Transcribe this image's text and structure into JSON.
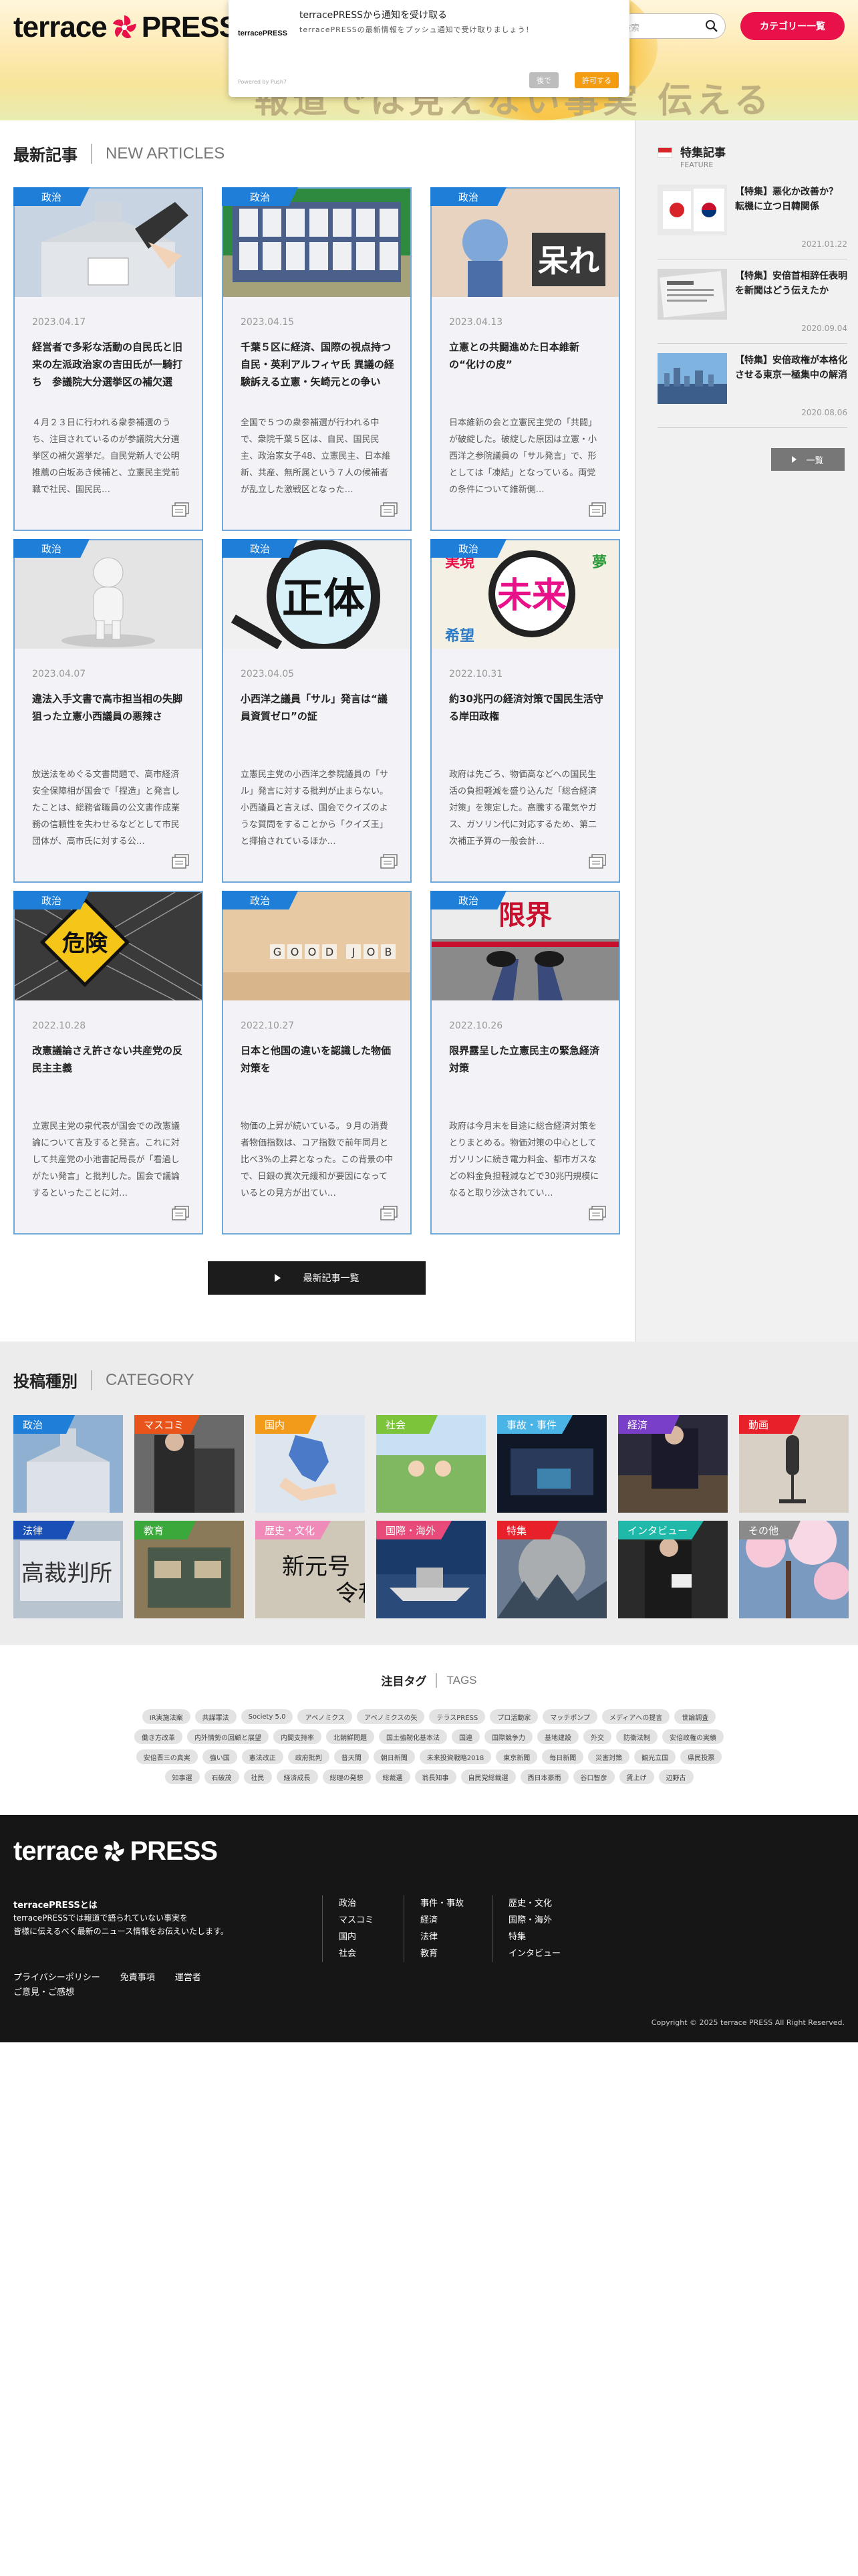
{
  "header": {
    "logo_left": "terrace",
    "logo_right": "PRESS",
    "banner_text": "報道では見えない事実 伝える",
    "search_placeholder": "検索",
    "category_button": "カテゴリー一覧"
  },
  "notification": {
    "logo": "terracePRESS",
    "title": "terracePRESSから通知を受け取る",
    "body": "terracePRESSの最新情報をプッシュ通知で受け取りましょう！",
    "powered": "Powered by Push7",
    "later": "後で",
    "allow": "許可する"
  },
  "new_articles": {
    "title_jp": "最新記事",
    "title_en": "NEW ARTICLES",
    "more_button": "最新記事一覧",
    "articles": [
      {
        "category": "政治",
        "date": "2023.04.17",
        "title": "経営者で多彩な活動の自民氏と旧来の左派政治家の吉田氏が一騎打ち　参議院大分選挙区の補欠選",
        "excerpt": "４月２３日に行われる衆参補選のうち、注目されているのが参議院大分選挙区の補欠選挙だ。自民党新人で公明推薦の白坂あき候補と、立憲民主党前職で社民、国民民…"
      },
      {
        "category": "政治",
        "date": "2023.04.15",
        "title": "千葉５区に経済、国際の視点持つ自民・英利アルフィヤ氏 異議の経験訴える立憲・矢崎元との争い",
        "excerpt": "全国で５つの衆参補選が行われる中で、衆院千葉５区は、自民、国民民主、政治家女子48、立憲民主、日本維新、共産、無所属という７人の候補者が乱立した激戦区となった…"
      },
      {
        "category": "政治",
        "date": "2023.04.13",
        "title": "立憲との共闘進めた日本維新の“化けの皮”",
        "excerpt": "日本維新の会と立憲民主党の「共闘」が破綻した。破綻した原因は立憲・小西洋之参院議員の「サル発言」で、形としては「凍結」となっている。両党の条件について維新側…"
      },
      {
        "category": "政治",
        "date": "2023.04.07",
        "title": "違法入手文書で高市担当相の失脚狙った立憲小西議員の悪辣さ",
        "excerpt": "放送法をめぐる文書問題で、高市経済安全保障相が国会で「捏造」と発言したことは、総務省職員の公文書作成業務の信頼性を失わせるなどとして市民団体が、高市氏に対する公…"
      },
      {
        "category": "政治",
        "date": "2023.04.05",
        "title": "小西洋之議員「サル」発言は“議員資質ゼロ”の証",
        "excerpt": "立憲民主党の小西洋之参院議員の「サル」発言に対する批判が止まらない。小西議員と言えば、国会でクイズのような質問をすることから「クイズ王」と揶揄されているほか…"
      },
      {
        "category": "政治",
        "date": "2022.10.31",
        "title": "約30兆円の経済対策で国民生活守る岸田政権",
        "excerpt": "政府は先ごろ、物価高などへの国民生活の負担軽減を盛り込んだ「総合経済対策」を策定した。高騰する電気やガス、ガソリン代に対応するため、第二次補正予算の一般会計…"
      },
      {
        "category": "政治",
        "date": "2022.10.28",
        "title": "改憲議論さえ許さない共産党の反民主主義",
        "excerpt": "立憲民主党の泉代表が国会での改憲議論について言及すると発言。これに対して共産党の小池書記局長が「看過しがたい発言」と批判した。国会で議論するといったことに対…"
      },
      {
        "category": "政治",
        "date": "2022.10.27",
        "title": "日本と他国の違いを認識した物価対策を",
        "excerpt": "物価の上昇が続いている。９月の消費者物価指数は、コア指数で前年同月と比べ3%の上昇となった。この背景の中で、日銀の異次元緩和が要因になっているとの見方が出てい…"
      },
      {
        "category": "政治",
        "date": "2022.10.26",
        "title": "限界露呈した立憲民主の緊急経済対策",
        "excerpt": "政府は今月末を目途に総合経済対策をとりまとめる。物価対策の中心としてガソリンに続き電力料金、都市ガスなどの料金負担軽減などで30兆円規模になると取り沙汰されてい…"
      }
    ]
  },
  "features": {
    "title_jp": "特集記事",
    "title_en": "FEATURE",
    "more_button": "一覧",
    "items": [
      {
        "title": "【特集】悪化か改善か？ 転機に立つ日韓関係",
        "date": "2021.01.22"
      },
      {
        "title": "【特集】安倍首相辞任表明を新聞はどう伝えたか",
        "date": "2020.09.04"
      },
      {
        "title": "【特集】安倍政権が本格化させる東京一極集中の解消",
        "date": "2020.08.06"
      }
    ]
  },
  "categories": {
    "title_jp": "投稿種別",
    "title_en": "CATEGORY",
    "items": [
      {
        "label": "政治",
        "color": "#1f7fd8"
      },
      {
        "label": "マスコミ",
        "color": "#e8541a"
      },
      {
        "label": "国内",
        "color": "#f29a1a"
      },
      {
        "label": "社会",
        "color": "#7cc43a"
      },
      {
        "label": "事故・事件",
        "color": "#4bb4e6"
      },
      {
        "label": "経済",
        "color": "#7a3fc8"
      },
      {
        "label": "動画",
        "color": "#e8202a"
      },
      {
        "label": "法律",
        "color": "#1a4fb8"
      },
      {
        "label": "教育",
        "color": "#3aa83a"
      },
      {
        "label": "歴史・文化",
        "color": "#f08ab8"
      },
      {
        "label": "国際・海外",
        "color": "#e84a7a"
      },
      {
        "label": "特集",
        "color": "#e8202a"
      },
      {
        "label": "インタビュー",
        "color": "#20b8a8"
      },
      {
        "label": "その他",
        "color": "#8a8a8a"
      }
    ]
  },
  "tags": {
    "title_jp": "注目タグ",
    "title_en": "TAGS",
    "rows": [
      [
        "IR実施法案",
        "共謀罪法",
        "Society 5.0",
        "アベノミクス",
        "アベノミクスの矢",
        "テラスPRESS",
        "プロ活動家",
        "マッチポンプ",
        "メディアへの提言",
        "世論調査"
      ],
      [
        "働き方改革",
        "内外情勢の回顧と展望",
        "内閣支持率",
        "北朝鮮問題",
        "国土強靭化基本法",
        "国連",
        "国際競争力",
        "基地建設",
        "外交",
        "防衛法制",
        "安倍政権の実績"
      ],
      [
        "安倍晋三の真実",
        "強い国",
        "憲法改正",
        "政府批判",
        "普天間",
        "朝日新聞",
        "未来投資戦略2018",
        "東京新聞",
        "毎日新聞",
        "災害対策",
        "観光立国",
        "県民投票"
      ],
      [
        "知事選",
        "石破茂",
        "社民",
        "経済成長",
        "総理の発想",
        "総裁選",
        "翁長知事",
        "自民党総裁選",
        "西日本豪雨",
        "谷口智彦",
        "賃上げ",
        "辺野古"
      ]
    ]
  },
  "footer": {
    "logo_left": "terrace",
    "logo_right": "PRESS",
    "about_title": "terracePRESSとは",
    "about_text": "terracePRESSでは報道で語られていない事実を\n皆様に伝えるべく最新のニュース情報をお伝えいたします。",
    "col1": [
      "政治",
      "マスコミ",
      "国内",
      "社会"
    ],
    "col2": [
      "事件・事故",
      "経済",
      "法律",
      "教育"
    ],
    "col3": [
      "歴史・文化",
      "国際・海外",
      "特集",
      "インタビュー"
    ],
    "links": [
      "プライバシーポリシー",
      "免責事項",
      "運営者"
    ],
    "contact": "ご意見・ご感想",
    "copyright": "Copyright © 2025 terrace PRESS All Right Reserved."
  }
}
